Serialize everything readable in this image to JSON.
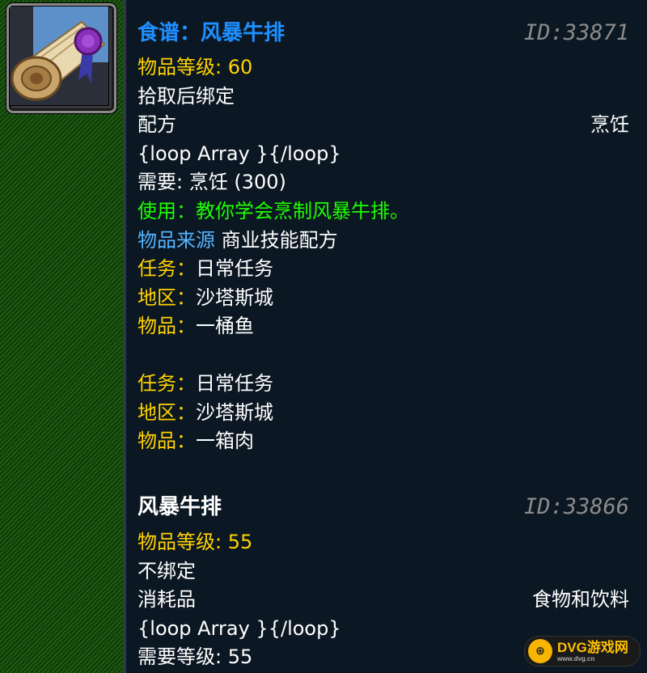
{
  "item1": {
    "title": "食谱：风暴牛排",
    "id": "ID:33871",
    "level_label": "物品等级:",
    "level_value": " 60",
    "bind": "拾取后绑定",
    "type": "配方",
    "subtype": "烹饪",
    "loop": "{loop Array }{/loop}",
    "requires": "需要: 烹饪 (300)",
    "use": "使用：教你学会烹制风暴牛排。",
    "source_label": "物品来源",
    "source_value": " 商业技能配方",
    "quests": [
      {
        "task_label": "任务：",
        "task_value": "日常任务",
        "zone_label": "地区：",
        "zone_value": "沙塔斯城",
        "item_label": "物品：",
        "item_value": "一桶鱼"
      },
      {
        "task_label": "任务：",
        "task_value": "日常任务",
        "zone_label": "地区：",
        "zone_value": "沙塔斯城",
        "item_label": "物品：",
        "item_value": "一箱肉"
      }
    ]
  },
  "item2": {
    "title": "风暴牛排",
    "id": "ID:33866",
    "level_label": "物品等级:",
    "level_value": " 55",
    "bind": "不绑定",
    "type": "消耗品",
    "subtype": "食物和饮料",
    "loop": "{loop Array }{/loop}",
    "requires": "需要等级: 55"
  },
  "watermark": {
    "brand": "DVG游戏网",
    "url": "www.dvg.cn"
  },
  "colors": {
    "title_blue": "#1e90ff",
    "label_yellow": "#ffd200",
    "use_green": "#1eff00",
    "source_cyan": "#55b4ff",
    "id_gray": "#8a8a8a",
    "background": "#0b1722"
  },
  "icon": "recipe-scroll-icon"
}
